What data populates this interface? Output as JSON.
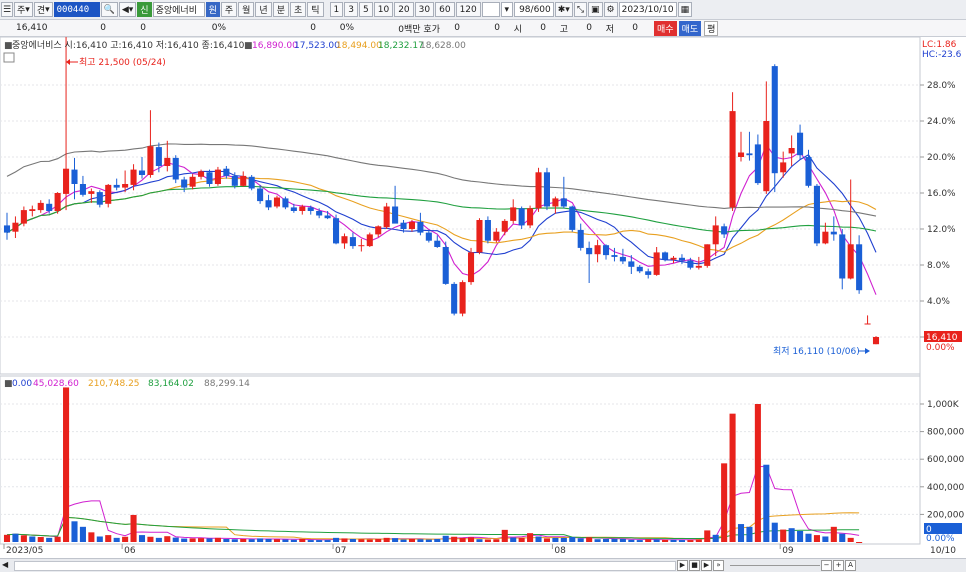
{
  "toolbar": {
    "market": "주",
    "view": "견",
    "code": "000440",
    "stock_label": "신",
    "stock_name": "중앙에너비",
    "won_label": "원",
    "period_tabs": [
      "주",
      "월",
      "년",
      "분",
      "초",
      "틱"
    ],
    "interval_tabs": [
      "1",
      "3",
      "5",
      "10",
      "20",
      "30",
      "60",
      "120"
    ],
    "count": "98",
    "count_total": "/600",
    "date": "2023/10/10"
  },
  "quote": {
    "price": "16,410",
    "change": "0",
    "volume": "0",
    "rate": "0%",
    "v1": "0",
    "v2": "0%",
    "hoga": "0백만 호가",
    "h1": "0",
    "h2": "0",
    "si": "시",
    "si_val": "0",
    "go": "고",
    "go_val": "0",
    "jeo": "저",
    "jeo_val": "0",
    "buy": "매수",
    "sell": "매도",
    "eval": "평"
  },
  "legend_main": {
    "prefix": "■",
    "name_ohlc": "중앙에너비스 시:16,410 고:16,410 저:16,410 종:16,410",
    "ma_marker": "■",
    "ma_values": [
      {
        "label": "16,890.00",
        "color": "#d020d0"
      },
      {
        "label": "17,523.00",
        "color": "#2040d0"
      },
      {
        "label": "18,494.00",
        "color": "#e8a020"
      },
      {
        "label": "18,232.17",
        "color": "#20a040"
      },
      {
        "label": "18,628.00",
        "color": "#777777"
      }
    ],
    "lc": "LC:1.86",
    "hc": "HC:-23.6"
  },
  "legend_volume": {
    "prefix": "■",
    "values": [
      {
        "label": "0.00",
        "color": "#2040d0"
      },
      {
        "label": "45,028.60",
        "color": "#d020d0"
      },
      {
        "label": "210,748.25",
        "color": "#e8a020"
      },
      {
        "label": "83,164.02",
        "color": "#20a040"
      },
      {
        "label": "88,299.14",
        "color": "#777777"
      }
    ]
  },
  "annotations": {
    "high": "최고 21,500 (05/24)",
    "low": "최저 16,110 (10/06)",
    "price_tag": "16,410",
    "price_pct": "0.00%",
    "vol_tag": "0",
    "vol_pct": "0.00%"
  },
  "colors": {
    "up": "#e8221c",
    "down": "#1a5fd6",
    "ma5": "#d020d0",
    "ma10": "#2040d0",
    "ma20": "#e8a020",
    "ma60": "#20a040",
    "ma120": "#777777",
    "pct_tag_bg": "#e8221c",
    "vol_tag_bg": "#1a5fd6"
  },
  "chart_data": {
    "type": "candlestick",
    "price_axis_ticks": [
      "28.0%",
      "24.0%",
      "20.0%",
      "16.0%",
      "12.0%",
      "8.0%",
      "4.0%",
      "0.00%"
    ],
    "price_axis_pct": [
      28,
      24,
      20,
      16,
      12,
      8,
      4,
      0
    ],
    "volume_axis_ticks": [
      "1,000K",
      "800,000",
      "600,000",
      "400,000",
      "200,000"
    ],
    "volume_axis_values": [
      1000000,
      800000,
      600000,
      400000,
      200000
    ],
    "x_labels": [
      "2023/05",
      "06",
      "07",
      "08",
      "09",
      "10",
      "10/10"
    ],
    "candles": [
      {
        "o": 12.4,
        "h": 13.8,
        "l": 10.8,
        "c": 11.6
      },
      {
        "o": 11.7,
        "h": 13.4,
        "l": 11.0,
        "c": 12.7
      },
      {
        "o": 12.6,
        "h": 14.5,
        "l": 12.3,
        "c": 14.1
      },
      {
        "o": 14.0,
        "h": 14.6,
        "l": 13.4,
        "c": 14.2
      },
      {
        "o": 14.1,
        "h": 15.2,
        "l": 13.8,
        "c": 14.9
      },
      {
        "o": 14.8,
        "h": 15.3,
        "l": 13.7,
        "c": 14.0
      },
      {
        "o": 14.0,
        "h": 16.1,
        "l": 13.7,
        "c": 16.0
      },
      {
        "o": 15.9,
        "h": 35.0,
        "l": 14.1,
        "c": 18.7
      },
      {
        "o": 18.6,
        "h": 19.9,
        "l": 15.3,
        "c": 17.0
      },
      {
        "o": 17.0,
        "h": 17.9,
        "l": 15.6,
        "c": 15.8
      },
      {
        "o": 15.9,
        "h": 16.5,
        "l": 14.9,
        "c": 16.2
      },
      {
        "o": 16.1,
        "h": 16.3,
        "l": 14.4,
        "c": 14.7
      },
      {
        "o": 14.8,
        "h": 17.0,
        "l": 14.4,
        "c": 16.9
      },
      {
        "o": 16.9,
        "h": 17.6,
        "l": 16.3,
        "c": 16.6
      },
      {
        "o": 16.6,
        "h": 18.5,
        "l": 16.1,
        "c": 17.0
      },
      {
        "o": 16.9,
        "h": 19.2,
        "l": 16.3,
        "c": 18.6
      },
      {
        "o": 18.5,
        "h": 20.0,
        "l": 17.6,
        "c": 18.0
      },
      {
        "o": 18.0,
        "h": 25.2,
        "l": 17.7,
        "c": 21.2
      },
      {
        "o": 21.1,
        "h": 21.6,
        "l": 18.3,
        "c": 19.0
      },
      {
        "o": 19.0,
        "h": 21.8,
        "l": 18.4,
        "c": 19.9
      },
      {
        "o": 19.9,
        "h": 20.2,
        "l": 17.1,
        "c": 17.5
      },
      {
        "o": 17.5,
        "h": 17.8,
        "l": 16.1,
        "c": 16.6
      },
      {
        "o": 16.7,
        "h": 18.1,
        "l": 16.4,
        "c": 17.8
      },
      {
        "o": 17.8,
        "h": 18.6,
        "l": 17.5,
        "c": 18.4
      },
      {
        "o": 18.3,
        "h": 18.6,
        "l": 16.7,
        "c": 17.0
      },
      {
        "o": 17.0,
        "h": 18.9,
        "l": 16.8,
        "c": 18.6
      },
      {
        "o": 18.7,
        "h": 19.0,
        "l": 17.6,
        "c": 17.9
      },
      {
        "o": 17.9,
        "h": 18.3,
        "l": 16.5,
        "c": 16.8
      },
      {
        "o": 16.8,
        "h": 18.4,
        "l": 16.7,
        "c": 17.9
      },
      {
        "o": 17.8,
        "h": 18.0,
        "l": 16.3,
        "c": 16.5
      },
      {
        "o": 16.5,
        "h": 16.9,
        "l": 14.8,
        "c": 15.1
      },
      {
        "o": 15.2,
        "h": 15.8,
        "l": 14.1,
        "c": 14.4
      },
      {
        "o": 14.5,
        "h": 15.7,
        "l": 14.3,
        "c": 15.5
      },
      {
        "o": 15.4,
        "h": 15.6,
        "l": 14.2,
        "c": 14.4
      },
      {
        "o": 14.4,
        "h": 14.8,
        "l": 13.8,
        "c": 14.0
      },
      {
        "o": 14.0,
        "h": 14.7,
        "l": 13.6,
        "c": 14.5
      },
      {
        "o": 14.4,
        "h": 14.6,
        "l": 13.6,
        "c": 14.0
      },
      {
        "o": 14.0,
        "h": 14.3,
        "l": 13.2,
        "c": 13.5
      },
      {
        "o": 13.5,
        "h": 14.0,
        "l": 13.1,
        "c": 13.2
      },
      {
        "o": 13.2,
        "h": 13.6,
        "l": 10.3,
        "c": 10.4
      },
      {
        "o": 10.4,
        "h": 11.5,
        "l": 9.8,
        "c": 11.2
      },
      {
        "o": 11.1,
        "h": 11.6,
        "l": 9.8,
        "c": 10.1
      },
      {
        "o": 10.1,
        "h": 10.9,
        "l": 9.5,
        "c": 10.2
      },
      {
        "o": 10.1,
        "h": 11.6,
        "l": 10.0,
        "c": 11.4
      },
      {
        "o": 11.4,
        "h": 12.4,
        "l": 11.1,
        "c": 12.3
      },
      {
        "o": 12.2,
        "h": 14.9,
        "l": 12.0,
        "c": 14.5
      },
      {
        "o": 14.5,
        "h": 16.8,
        "l": 14.4,
        "c": 12.6
      },
      {
        "o": 12.7,
        "h": 13.0,
        "l": 11.6,
        "c": 12.0
      },
      {
        "o": 12.0,
        "h": 13.0,
        "l": 11.7,
        "c": 12.8
      },
      {
        "o": 12.8,
        "h": 13.8,
        "l": 11.3,
        "c": 11.6
      },
      {
        "o": 11.6,
        "h": 11.9,
        "l": 10.5,
        "c": 10.7
      },
      {
        "o": 10.7,
        "h": 11.3,
        "l": 9.9,
        "c": 10.0
      },
      {
        "o": 10.0,
        "h": 10.6,
        "l": 5.8,
        "c": 5.9
      },
      {
        "o": 5.9,
        "h": 6.1,
        "l": 2.4,
        "c": 2.6
      },
      {
        "o": 2.6,
        "h": 6.3,
        "l": 2.3,
        "c": 6.1
      },
      {
        "o": 6.1,
        "h": 9.9,
        "l": 5.8,
        "c": 9.4
      },
      {
        "o": 9.4,
        "h": 13.2,
        "l": 9.2,
        "c": 13.0
      },
      {
        "o": 13.0,
        "h": 13.4,
        "l": 10.4,
        "c": 10.7
      },
      {
        "o": 10.7,
        "h": 12.1,
        "l": 10.5,
        "c": 11.7
      },
      {
        "o": 11.7,
        "h": 13.1,
        "l": 11.3,
        "c": 12.9
      },
      {
        "o": 12.9,
        "h": 15.3,
        "l": 12.6,
        "c": 14.4
      },
      {
        "o": 14.3,
        "h": 14.5,
        "l": 12.0,
        "c": 12.4
      },
      {
        "o": 12.4,
        "h": 14.6,
        "l": 12.1,
        "c": 14.3
      },
      {
        "o": 14.3,
        "h": 18.8,
        "l": 13.9,
        "c": 18.3
      },
      {
        "o": 18.3,
        "h": 18.8,
        "l": 14.1,
        "c": 14.5
      },
      {
        "o": 14.5,
        "h": 15.6,
        "l": 13.7,
        "c": 15.4
      },
      {
        "o": 15.4,
        "h": 17.8,
        "l": 14.3,
        "c": 14.5
      },
      {
        "o": 14.5,
        "h": 14.6,
        "l": 11.7,
        "c": 11.9
      },
      {
        "o": 11.9,
        "h": 12.6,
        "l": 9.6,
        "c": 9.9
      },
      {
        "o": 9.9,
        "h": 10.6,
        "l": 6.0,
        "c": 9.2
      },
      {
        "o": 9.2,
        "h": 10.8,
        "l": 8.3,
        "c": 10.2
      },
      {
        "o": 10.2,
        "h": 10.3,
        "l": 8.6,
        "c": 9.1
      },
      {
        "o": 9.1,
        "h": 9.9,
        "l": 8.4,
        "c": 8.9
      },
      {
        "o": 8.9,
        "h": 9.8,
        "l": 8.1,
        "c": 8.4
      },
      {
        "o": 8.4,
        "h": 9.1,
        "l": 7.0,
        "c": 7.8
      },
      {
        "o": 7.8,
        "h": 8.0,
        "l": 7.1,
        "c": 7.3
      },
      {
        "o": 7.3,
        "h": 7.6,
        "l": 6.5,
        "c": 6.9
      },
      {
        "o": 6.9,
        "h": 10.0,
        "l": 6.8,
        "c": 9.4
      },
      {
        "o": 9.4,
        "h": 9.5,
        "l": 8.4,
        "c": 8.6
      },
      {
        "o": 8.6,
        "h": 9.0,
        "l": 8.2,
        "c": 8.8
      },
      {
        "o": 8.8,
        "h": 9.2,
        "l": 8.1,
        "c": 8.5
      },
      {
        "o": 8.5,
        "h": 8.8,
        "l": 7.5,
        "c": 7.7
      },
      {
        "o": 7.7,
        "h": 8.9,
        "l": 7.5,
        "c": 7.9
      },
      {
        "o": 7.9,
        "h": 10.3,
        "l": 7.7,
        "c": 10.3
      },
      {
        "o": 10.3,
        "h": 13.4,
        "l": 9.0,
        "c": 12.4
      },
      {
        "o": 12.3,
        "h": 12.6,
        "l": 11.0,
        "c": 11.4
      },
      {
        "o": 14.4,
        "h": 27.2,
        "l": 14.0,
        "c": 25.1
      },
      {
        "o": 20.0,
        "h": 22.8,
        "l": 19.5,
        "c": 20.5
      },
      {
        "o": 20.4,
        "h": 22.8,
        "l": 19.6,
        "c": 20.2
      },
      {
        "o": 21.4,
        "h": 22.5,
        "l": 16.9,
        "c": 17.1
      },
      {
        "o": 16.2,
        "h": 28.4,
        "l": 15.9,
        "c": 24.0
      },
      {
        "o": 30.1,
        "h": 30.3,
        "l": 16.1,
        "c": 18.2
      },
      {
        "o": 18.3,
        "h": 20.6,
        "l": 17.7,
        "c": 19.4
      },
      {
        "o": 20.4,
        "h": 22.4,
        "l": 19.0,
        "c": 21.0
      },
      {
        "o": 22.7,
        "h": 23.6,
        "l": 19.7,
        "c": 20.2
      },
      {
        "o": 20.0,
        "h": 20.8,
        "l": 16.6,
        "c": 16.8
      },
      {
        "o": 16.8,
        "h": 17.0,
        "l": 10.1,
        "c": 10.4
      },
      {
        "o": 10.4,
        "h": 12.7,
        "l": 10.3,
        "c": 11.7
      },
      {
        "o": 11.7,
        "h": 13.4,
        "l": 10.7,
        "c": 11.4
      },
      {
        "o": 11.4,
        "h": 12.0,
        "l": 5.3,
        "c": 6.5
      },
      {
        "o": 6.5,
        "h": 17.5,
        "l": 6.4,
        "c": 10.3
      },
      {
        "o": 10.3,
        "h": 11.3,
        "l": 4.8,
        "c": 5.2
      },
      {
        "o": 1.5,
        "h": 2.4,
        "l": 1.5,
        "c": 1.5
      },
      {
        "o": -0.8,
        "h": 0.1,
        "l": -0.8,
        "c": 0.0
      }
    ],
    "volumes": [
      {
        "v": 52000,
        "up": true
      },
      {
        "v": 60000,
        "up": false
      },
      {
        "v": 48000,
        "up": true
      },
      {
        "v": 40000,
        "up": false
      },
      {
        "v": 36000,
        "up": true
      },
      {
        "v": 30000,
        "up": false
      },
      {
        "v": 38000,
        "up": true
      },
      {
        "v": 1120000,
        "up": true
      },
      {
        "v": 150000,
        "up": false
      },
      {
        "v": 110000,
        "up": false
      },
      {
        "v": 70000,
        "up": true
      },
      {
        "v": 40000,
        "up": false
      },
      {
        "v": 50000,
        "up": true
      },
      {
        "v": 30000,
        "up": false
      },
      {
        "v": 38000,
        "up": true
      },
      {
        "v": 196000,
        "up": true
      },
      {
        "v": 50000,
        "up": false
      },
      {
        "v": 38000,
        "up": true
      },
      {
        "v": 30000,
        "up": false
      },
      {
        "v": 42000,
        "up": true
      },
      {
        "v": 32000,
        "up": false
      },
      {
        "v": 25000,
        "up": false
      },
      {
        "v": 26000,
        "up": true
      },
      {
        "v": 28000,
        "up": true
      },
      {
        "v": 26000,
        "up": false
      },
      {
        "v": 30000,
        "up": true
      },
      {
        "v": 22000,
        "up": false
      },
      {
        "v": 20000,
        "up": false
      },
      {
        "v": 22000,
        "up": true
      },
      {
        "v": 20000,
        "up": false
      },
      {
        "v": 26000,
        "up": false
      },
      {
        "v": 22000,
        "up": false
      },
      {
        "v": 20000,
        "up": true
      },
      {
        "v": 18000,
        "up": false
      },
      {
        "v": 16000,
        "up": false
      },
      {
        "v": 22000,
        "up": true
      },
      {
        "v": 14000,
        "up": false
      },
      {
        "v": 14000,
        "up": false
      },
      {
        "v": 14000,
        "up": false
      },
      {
        "v": 30000,
        "up": false
      },
      {
        "v": 26000,
        "up": true
      },
      {
        "v": 22000,
        "up": false
      },
      {
        "v": 20000,
        "up": true
      },
      {
        "v": 18000,
        "up": true
      },
      {
        "v": 22000,
        "up": true
      },
      {
        "v": 30000,
        "up": true
      },
      {
        "v": 28000,
        "up": false
      },
      {
        "v": 18000,
        "up": false
      },
      {
        "v": 22000,
        "up": true
      },
      {
        "v": 20000,
        "up": false
      },
      {
        "v": 18000,
        "up": false
      },
      {
        "v": 22000,
        "up": false
      },
      {
        "v": 45000,
        "up": false
      },
      {
        "v": 38000,
        "up": true
      },
      {
        "v": 30000,
        "up": true
      },
      {
        "v": 34000,
        "up": true
      },
      {
        "v": 20000,
        "up": false
      },
      {
        "v": 18000,
        "up": true
      },
      {
        "v": 20000,
        "up": true
      },
      {
        "v": 88000,
        "up": true
      },
      {
        "v": 32000,
        "up": false
      },
      {
        "v": 30000,
        "up": true
      },
      {
        "v": 64000,
        "up": true
      },
      {
        "v": 40000,
        "up": false
      },
      {
        "v": 26000,
        "up": true
      },
      {
        "v": 30000,
        "up": false
      },
      {
        "v": 30000,
        "up": false
      },
      {
        "v": 36000,
        "up": false
      },
      {
        "v": 26000,
        "up": false
      },
      {
        "v": 34000,
        "up": true
      },
      {
        "v": 20000,
        "up": false
      },
      {
        "v": 22000,
        "up": false
      },
      {
        "v": 22000,
        "up": false
      },
      {
        "v": 22000,
        "up": false
      },
      {
        "v": 16000,
        "up": false
      },
      {
        "v": 14000,
        "up": false
      },
      {
        "v": 20000,
        "up": true
      },
      {
        "v": 18000,
        "up": false
      },
      {
        "v": 16000,
        "up": true
      },
      {
        "v": 16000,
        "up": false
      },
      {
        "v": 14000,
        "up": false
      },
      {
        "v": 14000,
        "up": true
      },
      {
        "v": 18000,
        "up": true
      },
      {
        "v": 84000,
        "up": true
      },
      {
        "v": 52000,
        "up": false
      },
      {
        "v": 570000,
        "up": true
      },
      {
        "v": 930000,
        "up": true
      },
      {
        "v": 130000,
        "up": false
      },
      {
        "v": 110000,
        "up": false
      },
      {
        "v": 1000000,
        "up": true
      },
      {
        "v": 560000,
        "up": false
      },
      {
        "v": 140000,
        "up": false
      },
      {
        "v": 90000,
        "up": true
      },
      {
        "v": 100000,
        "up": false
      },
      {
        "v": 80000,
        "up": false
      },
      {
        "v": 60000,
        "up": false
      },
      {
        "v": 50000,
        "up": true
      },
      {
        "v": 40000,
        "up": false
      },
      {
        "v": 110000,
        "up": true
      },
      {
        "v": 60000,
        "up": false
      },
      {
        "v": 30000,
        "up": true
      },
      {
        "v": 0,
        "up": true
      }
    ]
  },
  "scrollbar": {
    "ctl": "▶ ■ ▶ ▶"
  }
}
